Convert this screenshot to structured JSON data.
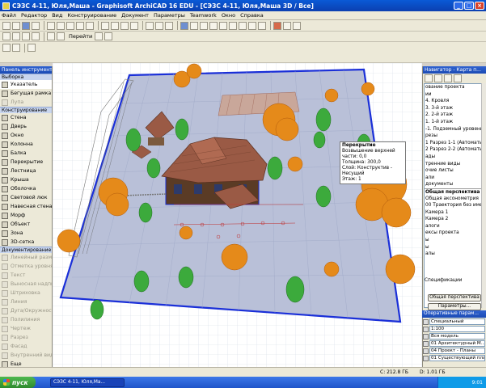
{
  "window": {
    "title": "СЭЗС 4-11, Юля,Маша - Graphisoft ArchiCAD 16 EDU - [СЭЗС 4-11, Юля,Маша 3D / Все]"
  },
  "menu": [
    "Файл",
    "Редактор",
    "Вид",
    "Конструирование",
    "Документ",
    "Параметры",
    "Teamwork",
    "Окно",
    "Справка"
  ],
  "toolbar": {
    "goto_label": "Перейти"
  },
  "toolbox": {
    "title": "Панель инструмент...",
    "select_header": "Выборка",
    "select_items": [
      "Указатель",
      "Бегущая рамка",
      "Лупа"
    ],
    "construct_header": "Конструирование",
    "construct_items": [
      "Стена",
      "Дверь",
      "Окно",
      "Колонна",
      "Балка",
      "Перекрытие",
      "Лестница",
      "Крыша",
      "Оболочка",
      "Световой люк",
      "Навесная стена",
      "Морф",
      "Объект",
      "Зона",
      "3D-сетка"
    ],
    "doc_header": "Документирование",
    "doc_items": [
      "Линейный размер",
      "Отметка уровня",
      "Текст",
      "Выносная надпись",
      "Штриховка",
      "Линия",
      "Дуга/Окружность",
      "Полилиния",
      "Чертеж",
      "Разрез",
      "Фасад",
      "Внутренний вид"
    ],
    "more_label": "Еще"
  },
  "navigator": {
    "title": "Навигатор - Карта п...",
    "items": [
      "ование проекта",
      "ии",
      "4. Кровля",
      "3. 3-й этаж",
      "2. 2-й этаж",
      "1. 1-й этаж",
      "-1. Подземный уровень",
      "резы",
      "1 Разрез 1-1 (Автоматическое",
      "2 Разрез 2-2 (Автоматическое",
      "ады",
      "тренние виды",
      "очие листы",
      "али",
      "документы"
    ],
    "section_title": "Общая перспектива",
    "section_items": [
      "Общая аксонометрия",
      "00 Траектория без имени",
      "Камера 1",
      "Камера 2",
      "алоги",
      "ексы проекта",
      "ы",
      "ы",
      "алы"
    ],
    "spec_label": "Спецификации",
    "perspective_button": "Общая перспектива",
    "params_button": "Параметры..."
  },
  "quick_params": {
    "title": "Оперативные парам...",
    "rows": [
      "Специальный",
      "1:100",
      "Вся модель",
      "01 Архитектурный М...",
      "04 Проект - Планы",
      "01 Существующий план"
    ]
  },
  "tooltip": {
    "title": "Перекрытие",
    "lines": [
      "Возвышение верхней части: 0,0",
      "Толщина: 300,0",
      "Слой: Конструктив - Несущий",
      "Этаж: 1"
    ]
  },
  "status": {
    "disk_c": "C: 212.8 ГБ",
    "disk_d": "D: 1.01 ГБ"
  },
  "taskbar": {
    "start_label": "пуск",
    "task_label": "СЭЗС 4-11, Юля,Ма...",
    "clock": "9:01"
  },
  "colors": {
    "title_blue": "#0b4fc4",
    "ground": "#b9c0d8",
    "roof": "#9a5a45",
    "tree_orange": "#e58a1a",
    "tree_green": "#3caa3c"
  }
}
